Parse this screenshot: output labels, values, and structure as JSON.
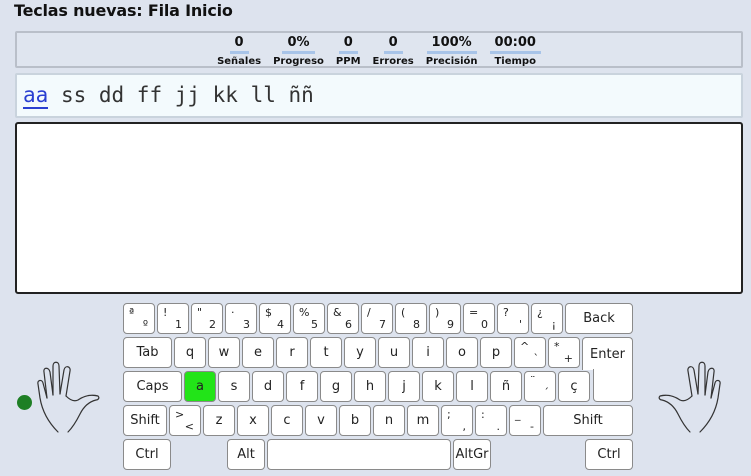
{
  "title": "Teclas nuevas: Fila Inicio",
  "stats": [
    {
      "value": "0",
      "label": "Señales"
    },
    {
      "value": "0%",
      "label": "Progreso"
    },
    {
      "value": "0",
      "label": "PPM"
    },
    {
      "value": "0",
      "label": "Errores"
    },
    {
      "value": "100%",
      "label": "Precisión"
    },
    {
      "value": "00:00",
      "label": "Tiempo"
    }
  ],
  "lesson": {
    "current": "aa",
    "rest": " ss dd ff jj kk ll ññ"
  },
  "typing": {
    "value": ""
  },
  "keys": {
    "row1": [
      [
        "ª",
        "º"
      ],
      [
        "!",
        "1"
      ],
      [
        "\"",
        "2"
      ],
      [
        "·",
        "3"
      ],
      [
        "$",
        "4"
      ],
      [
        "%",
        "5"
      ],
      [
        "&",
        "6"
      ],
      [
        "/",
        "7"
      ],
      [
        "(",
        "8"
      ],
      [
        ")",
        "9"
      ],
      [
        "=",
        "0"
      ],
      [
        "?",
        "'"
      ],
      [
        "¿",
        "¡"
      ]
    ],
    "back": "Back",
    "tab": "Tab",
    "row2": [
      "q",
      "w",
      "e",
      "r",
      "t",
      "y",
      "u",
      "i",
      "o",
      "p"
    ],
    "row2_dual": [
      [
        "^",
        "`"
      ],
      [
        "*",
        "+"
      ]
    ],
    "enter": "Enter",
    "caps": "Caps",
    "row3": [
      "a",
      "s",
      "d",
      "f",
      "g",
      "h",
      "j",
      "k",
      "l",
      "ñ"
    ],
    "row3_dual": [
      [
        "¨",
        "´"
      ]
    ],
    "row3_cedilla": "ç",
    "shift": "Shift",
    "angle": [
      ">",
      "<"
    ],
    "row4": [
      "z",
      "x",
      "c",
      "v",
      "b",
      "n",
      "m"
    ],
    "row4_dual": [
      [
        ";",
        ","
      ],
      [
        ":",
        "."
      ],
      [
        "_",
        "-"
      ]
    ],
    "ctrl": "Ctrl",
    "alt": "Alt",
    "altgr": "AltGr"
  },
  "active_key": "a",
  "colors": {
    "active_key": "#22e418",
    "indicator": "#1e7f25",
    "underline": "#a8c4e8"
  }
}
